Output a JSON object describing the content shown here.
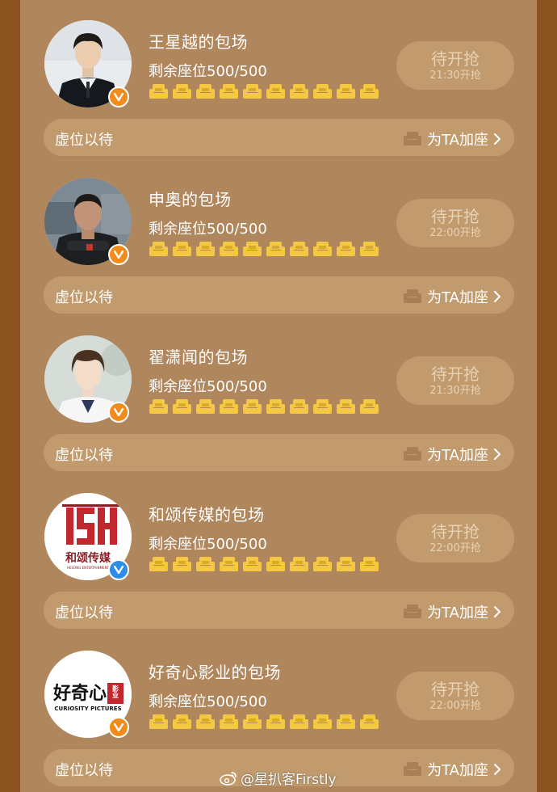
{
  "theme": {
    "background": "#8a531f",
    "panel": "#b0865c",
    "pill": "#c19b6e",
    "seat_gold": "#f4c842",
    "verified_orange": "#f28b1a",
    "verified_blue": "#2c8de8"
  },
  "entries": [
    {
      "title": "王星越的包场",
      "seats_text": "剩余座位500/500",
      "button_main": "待开抢",
      "button_time": "21:30开抢",
      "bar_left": "虚位以待",
      "bar_right": "为TA加座",
      "verified": "orange"
    },
    {
      "title": "申奥的包场",
      "seats_text": "剩余座位500/500",
      "button_main": "待开抢",
      "button_time": "22:00开抢",
      "bar_left": "虚位以待",
      "bar_right": "为TA加座",
      "verified": "orange"
    },
    {
      "title": "翟潇闻的包场",
      "seats_text": "剩余座位500/500",
      "button_main": "待开抢",
      "button_time": "21:30开抢",
      "bar_left": "虚位以待",
      "bar_right": "为TA加座",
      "verified": "orange"
    },
    {
      "title": "和颂传媒的包场",
      "seats_text": "剩余座位500/500",
      "button_main": "待开抢",
      "button_time": "22:00开抢",
      "bar_left": "虚位以待",
      "bar_right": "为TA加座",
      "verified": "blue",
      "logo_text": "和颂传媒",
      "logo_sub": "HESONG ENTERTAINMENT"
    },
    {
      "title": "好奇心影业的包场",
      "seats_text": "剩余座位500/500",
      "button_main": "待开抢",
      "button_time": "22:00开抢",
      "bar_left": "虚位以待",
      "bar_right": "为TA加座",
      "verified": "orange",
      "logo_text": "好奇心",
      "logo_seal": "影业",
      "logo_sub": "CURIOSITY PICTURES"
    }
  ],
  "watermark": "@星扒客Firstly",
  "icons": {
    "seat": "sofa-icon",
    "verified": "v-badge-icon",
    "chevron": "chevron-right-icon",
    "weibo": "weibo-icon"
  }
}
